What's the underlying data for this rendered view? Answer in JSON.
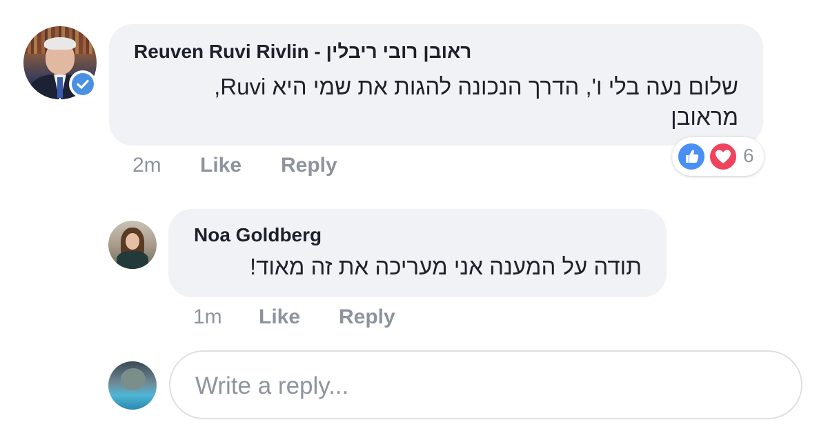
{
  "comments": [
    {
      "author": "Reuven Ruvi Rivlin - ראובן רובי ריבלין",
      "text_line1": "שלום נעה בלי ו', הדרך הנכונה להגות את שמי היא Ruvi,",
      "text_line2": "מראובן",
      "time": "2m",
      "like_label": "Like",
      "reply_label": "Reply",
      "reaction_count": "6",
      "reactions": [
        "like-icon",
        "love-icon"
      ],
      "verified": true
    },
    {
      "author": "Noa Goldberg",
      "text": "תודה על המענה אני מעריכה את זה מאוד!",
      "time": "1m",
      "like_label": "Like",
      "reply_label": "Reply"
    }
  ],
  "reply_box": {
    "placeholder": "Write a reply..."
  },
  "colors": {
    "bubble": "#f1f2f6",
    "meta": "#8d949e",
    "text": "#1d2129",
    "like_reaction": "#4a8ff5",
    "love_reaction": "#f0435d",
    "verified_badge": "#4a90e2"
  }
}
